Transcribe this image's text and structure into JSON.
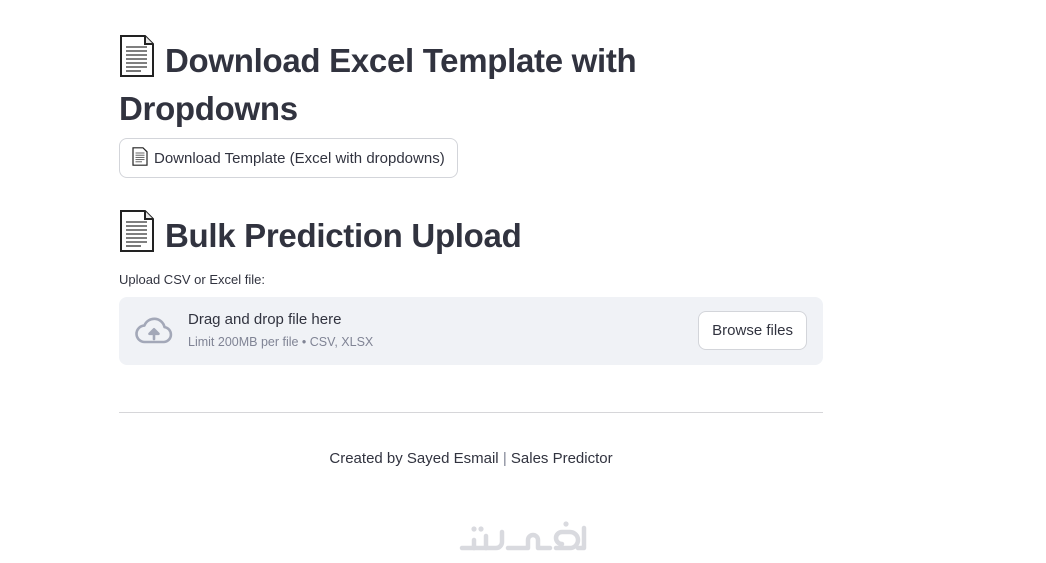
{
  "template_section": {
    "title": "Download Excel Template with Dropdowns",
    "title_icon": "page-facing-up-icon",
    "download_button_label": "Download Template (Excel with dropdowns)",
    "download_button_icon": "page-facing-up-icon"
  },
  "upload_section": {
    "title": "Bulk Prediction Upload",
    "title_icon": "page-facing-up-icon",
    "field_label": "Upload CSV or Excel file:",
    "dropzone": {
      "icon": "cloud-upload-icon",
      "main_text": "Drag and drop file here",
      "sub_text": "Limit 200MB per file • CSV, XLSX",
      "browse_button_label": "Browse files"
    }
  },
  "footer": {
    "created_by": "Created by Sayed Esmail",
    "separator": "|",
    "app_name": "Sales Predictor"
  },
  "watermark": {
    "text": "خمسات",
    "color": "#d9dadf"
  },
  "colors": {
    "text": "#31333f",
    "muted": "#808495",
    "dropzone_bg": "#f0f2f6",
    "border": "#d3d5da",
    "cloud_icon": "#a3a8b8"
  }
}
